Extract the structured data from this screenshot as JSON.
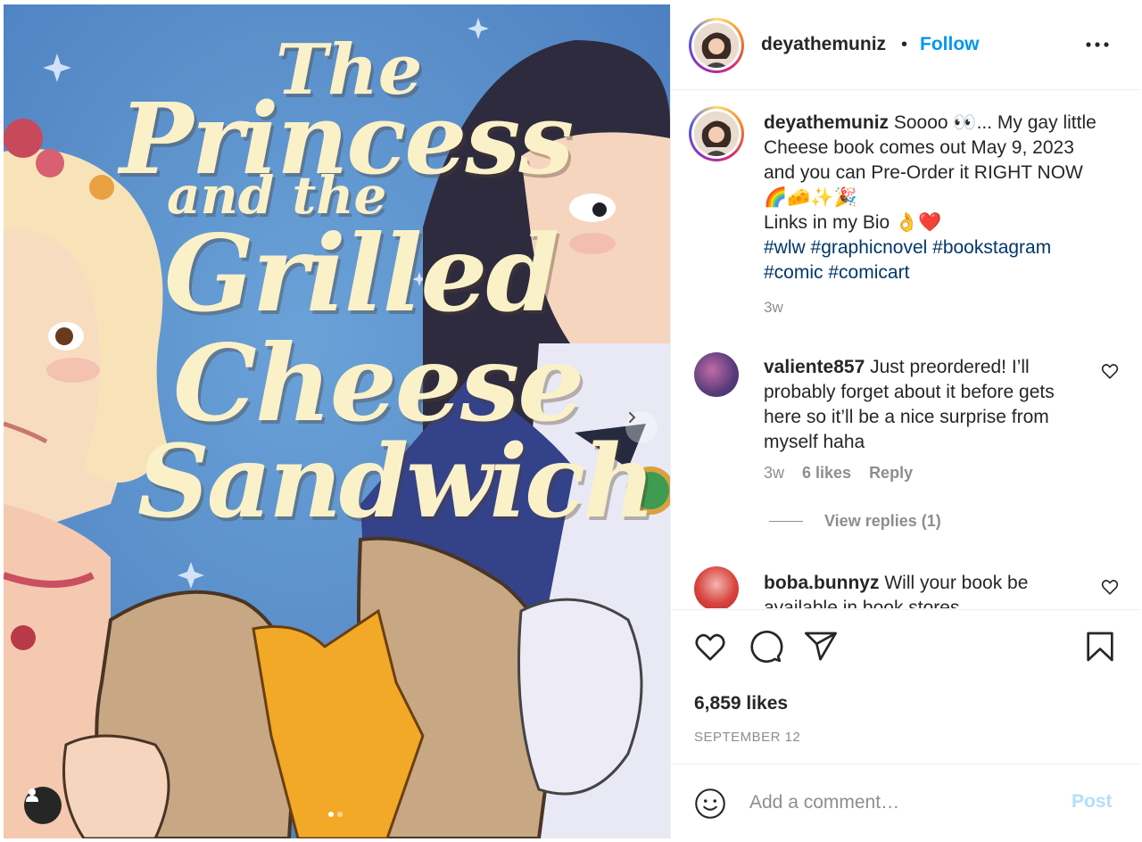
{
  "colors": {
    "accent": "#0095f6",
    "post_disabled": "#b2dffc",
    "hashtag": "#00376b",
    "secondary_text": "#8e8e8e"
  },
  "media": {
    "cover_title_lines": [
      "The",
      "Princess",
      "and the",
      "Grilled",
      "Cheese",
      "Sandwich"
    ],
    "icons": [
      "chevron-right-icon",
      "user-tag-icon"
    ]
  },
  "header": {
    "username": "deyathemuniz",
    "separator": "•",
    "follow_label": "Follow",
    "more_icon": "more-horizontal-icon"
  },
  "caption": {
    "username": "deyathemuniz",
    "line1": "Soooo 👀... My gay little Cheese book comes out May 9, 2023 and you can Pre-Order it RIGHT NOW 🌈🧀✨🎉",
    "line2": "Links in my Bio 👌❤️",
    "hashtags": [
      "#wlw",
      "#graphicnovel",
      "#bookstagram",
      "#comic",
      "#comicart"
    ],
    "time": "3w"
  },
  "comments": [
    {
      "username": "valiente857",
      "text": "Just preordered! I’ll probably forget about it before gets here so it’ll be a nice surprise from myself haha",
      "time": "3w",
      "likes": "6 likes",
      "reply_label": "Reply",
      "view_replies": "View replies (1)"
    },
    {
      "username": "boba.bunnyz",
      "text": "Will your book be available in book stores"
    }
  ],
  "actions": {
    "icons": [
      "heart-icon",
      "comment-icon",
      "share-icon",
      "bookmark-icon"
    ],
    "likes": "6,859 likes",
    "date": "SEPTEMBER 12"
  },
  "add_comment": {
    "placeholder": "Add a comment…",
    "post_label": "Post",
    "emoji_icon": "emoji-icon"
  }
}
